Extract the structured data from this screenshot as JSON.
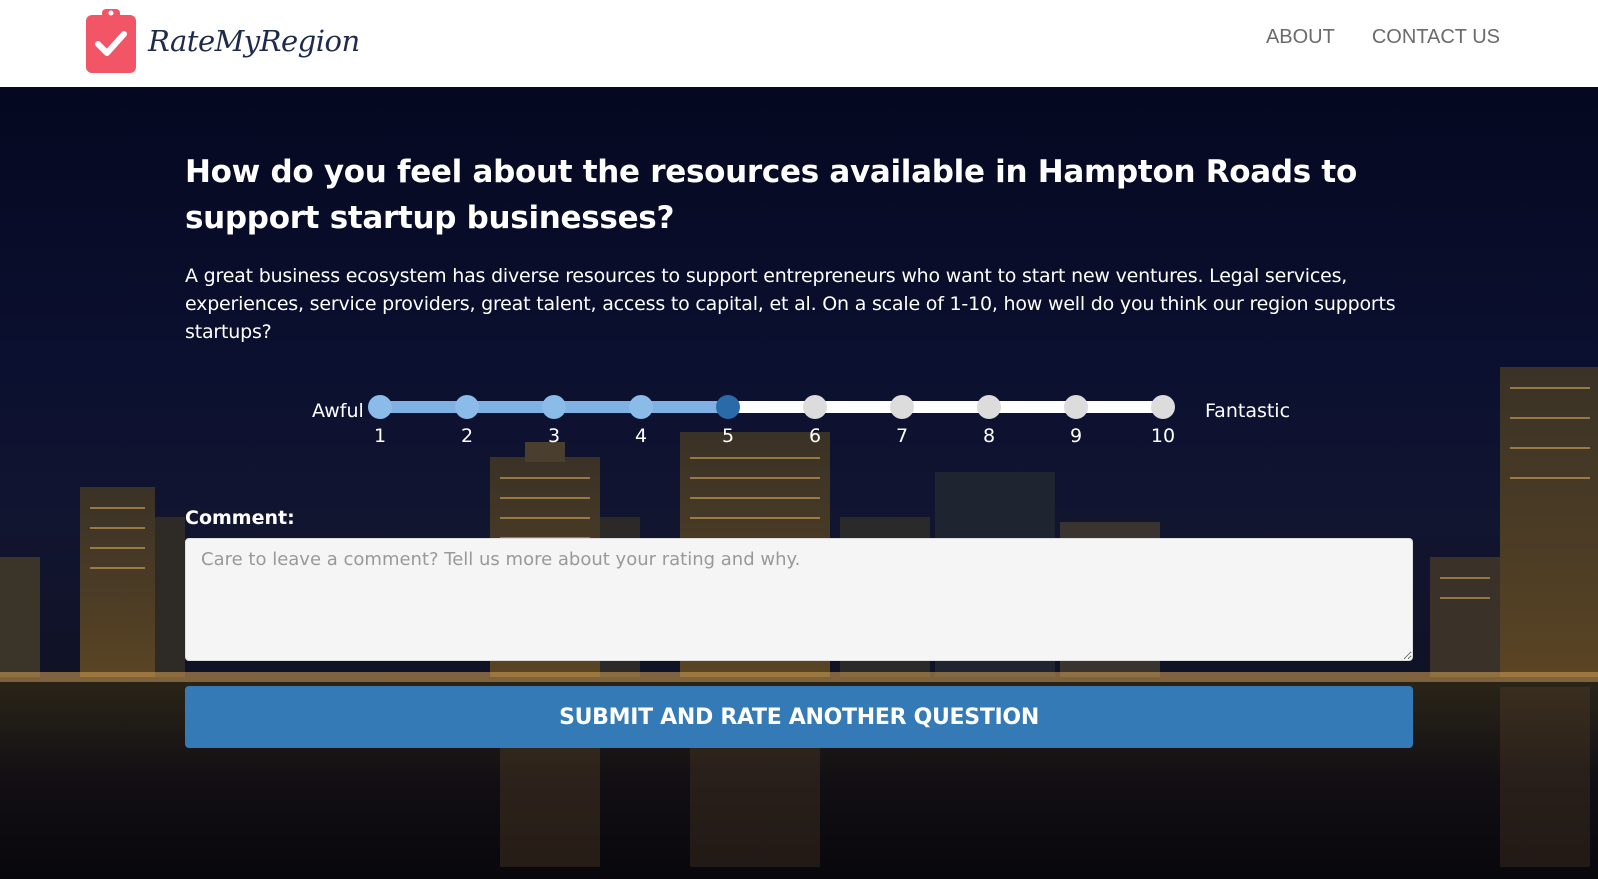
{
  "header": {
    "brand": "RateMyRegion",
    "nav": [
      {
        "label": "ABOUT"
      },
      {
        "label": "CONTACT US"
      }
    ]
  },
  "survey": {
    "question": "How do you feel about the resources available in Hampton Roads to support startup businesses?",
    "description": "A great business ecosystem has diverse resources to support entrepreneurs who want to start new ventures. Legal services, experiences, service providers, great talent, access to capital, et al. On a scale of 1-10, how well do you think our region supports startups?",
    "scale_low": "Awful",
    "scale_high": "Fantastic",
    "scale": [
      "1",
      "2",
      "3",
      "4",
      "5",
      "6",
      "7",
      "8",
      "9",
      "10"
    ],
    "selected_value": 5,
    "comment_label": "Comment:",
    "comment_placeholder": "Care to leave a comment? Tell us more about your rating and why.",
    "comment_value": "",
    "submit_label": "SUBMIT AND RATE ANOTHER QUESTION"
  },
  "colors": {
    "accent": "#337ab7",
    "logo": "#f25565",
    "slider_fill": "#7fb2e3",
    "slider_selected": "#2a6aa8"
  },
  "icons": {
    "logo": "clipboard-check-icon"
  }
}
